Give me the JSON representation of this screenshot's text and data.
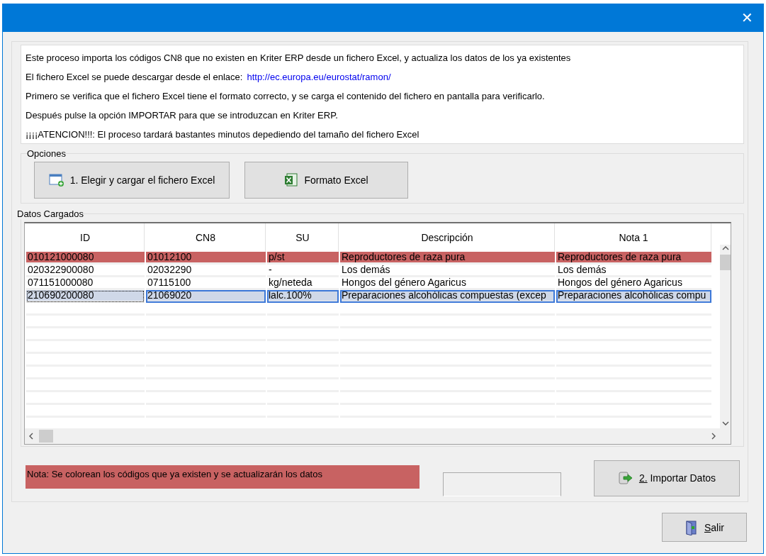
{
  "window": {
    "close": "✕"
  },
  "info_lines": [
    "Este proceso importa los códigos CN8 que no existen en Kriter ERP desde un fichero Excel, y actualiza los datos de los ya existentes",
    "El fichero Excel se puede descargar desde el enlace:",
    "Primero se verifica que el fichero Excel tiene el formato correcto, y se carga el contenido del fichero en pantalla para verificarlo.",
    "Después pulse la opción IMPORTAR para que se introduzcan en Kriter ERP.",
    "¡¡¡¡ATENCION!!!: El proceso tardará bastantes minutos depediendo del tamaño del fichero Excel"
  ],
  "download_link": "http://ec.europa.eu/eurostat/ramon/",
  "options": {
    "title": "Opciones",
    "buttons": [
      {
        "label": "1. Elegir y cargar el fichero Excel"
      },
      {
        "label": "Formato Excel"
      }
    ]
  },
  "data": {
    "title": "Datos Cargados",
    "table": {
      "columns": [
        "ID",
        "CN8",
        "SU",
        "Descripción",
        "Nota 1"
      ],
      "rows": [
        {
          "cells": [
            "010121000080",
            "01012100",
            "p/st",
            "Reproductores de raza pura",
            "Reproductores de raza pura"
          ],
          "existing": true,
          "selected": false
        },
        {
          "cells": [
            "020322900080",
            "02032290",
            "-",
            "Los demás",
            "Los demás"
          ],
          "existing": false,
          "selected": false
        },
        {
          "cells": [
            "071151000080",
            "07115100",
            "kg/neteda",
            "Hongos del género Agaricus",
            "Hongos del género Agaricus"
          ],
          "existing": false,
          "selected": false
        },
        {
          "cells": [
            "210690200080",
            "21069020",
            "lalc.100%",
            "Preparaciones alcohólicas compuestas (excep",
            "Preparaciones alcohólicas compu"
          ],
          "existing": false,
          "selected": true
        }
      ]
    }
  },
  "note": "Nota: Se colorean los códigos que ya existen y se actualizarán los datos",
  "import_button": {
    "label": "2. Importar Datos"
  },
  "exit_button": {
    "label": "Salir"
  }
}
